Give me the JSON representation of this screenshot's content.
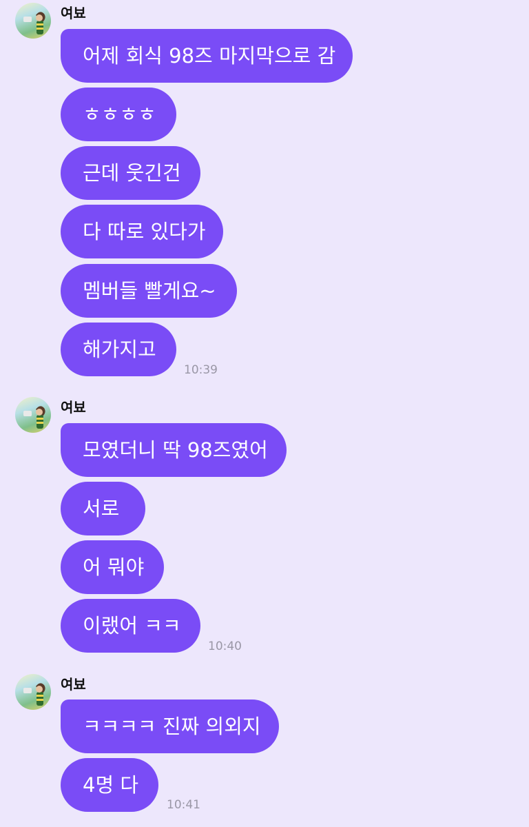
{
  "colors": {
    "background": "#ede7fc",
    "bubble": "#7a4cf6",
    "bubble_text": "#ffffff",
    "timestamp": "#9a97a6"
  },
  "groups": [
    {
      "sender": "여뵤",
      "avatar_icon": "profile-avatar-icon",
      "messages": [
        "어제 회식 98즈 마지막으로 감",
        "ㅎㅎㅎㅎ",
        "근데 웃긴건",
        "다 따로 있다가",
        "멤버들 빨게요~",
        "해가지고"
      ],
      "time": "10:39"
    },
    {
      "sender": "여뵤",
      "avatar_icon": "profile-avatar-icon",
      "messages": [
        "모였더니 딱 98즈였어",
        "서로",
        "어 뭐야",
        "이랬어 ㅋㅋ"
      ],
      "time": "10:40"
    },
    {
      "sender": "여뵤",
      "avatar_icon": "profile-avatar-icon",
      "messages": [
        "ㅋㅋㅋㅋ 진짜 의외지",
        "4명 다"
      ],
      "time": "10:41"
    }
  ]
}
